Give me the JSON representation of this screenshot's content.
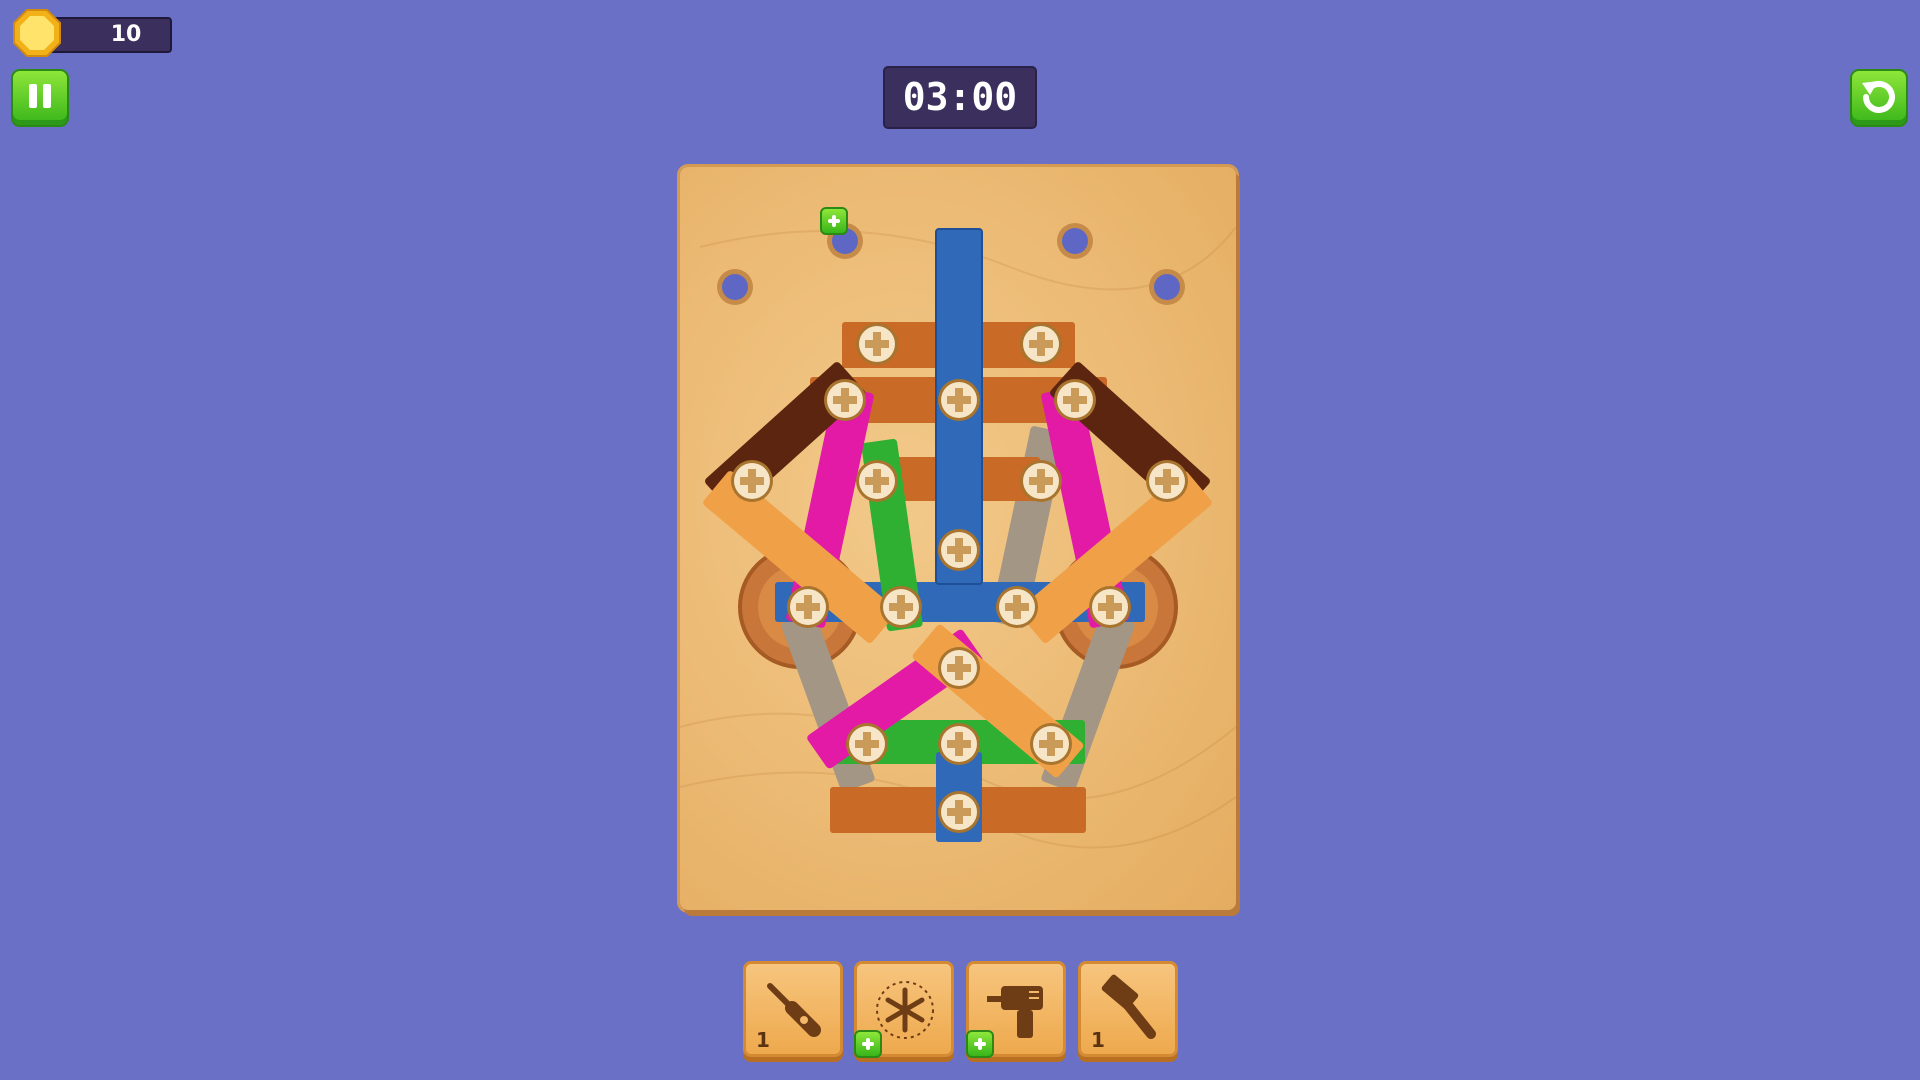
{
  "hud": {
    "coins": "10",
    "timer": "03:00"
  },
  "toolbar": {
    "tools": [
      {
        "name": "screwdriver",
        "count": "1"
      },
      {
        "name": "freeze",
        "count": ""
      },
      {
        "name": "drill",
        "count": ""
      },
      {
        "name": "hammer",
        "count": "1"
      }
    ]
  },
  "colors": {
    "background": "#6a70c6",
    "board": "#edbd78",
    "hud_panel": "#3b2f5e",
    "button_green": "#38b51a"
  }
}
